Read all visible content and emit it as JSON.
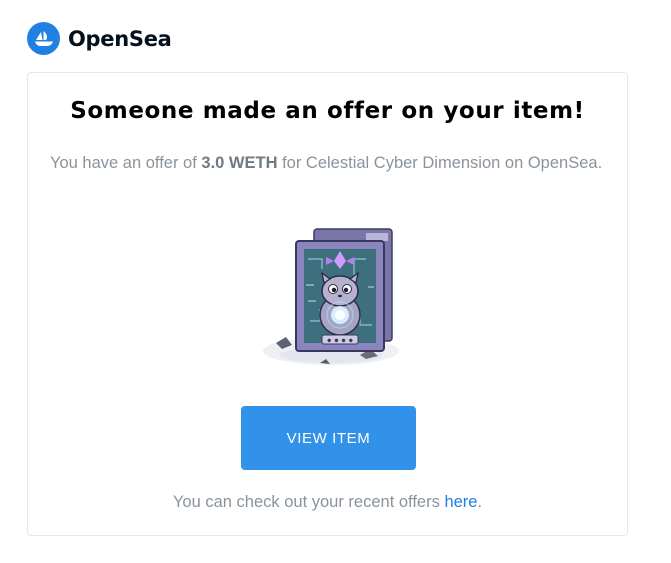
{
  "brand": {
    "name": "OpenSea",
    "color": "#2081e2"
  },
  "email": {
    "title": "Someone made an offer on your item!",
    "message": {
      "prefix": "You have an offer of ",
      "amount": "3.0 WETH",
      "middle": " for Celestial Cyber Dimension on OpenSea."
    },
    "button_label": "VIEW ITEM",
    "footer": {
      "text": "You can check out your recent offers ",
      "link_text": "here",
      "suffix": "."
    }
  },
  "colors": {
    "button": "#3291e9",
    "link": "#2081e2",
    "body_text": "#8a939b"
  }
}
